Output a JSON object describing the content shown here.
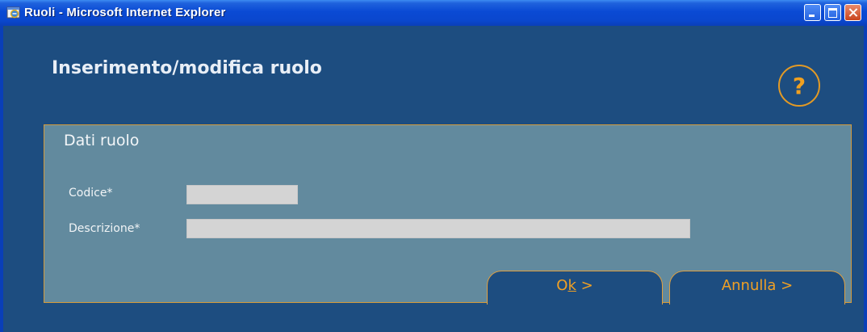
{
  "window": {
    "title": "Ruoli - Microsoft Internet Explorer"
  },
  "page": {
    "heading": "Inserimento/modifica ruolo",
    "help_symbol": "?"
  },
  "panel": {
    "title": "Dati ruolo",
    "fields": {
      "codice": {
        "label": "Codice*",
        "value": ""
      },
      "descrizione": {
        "label": "Descrizione*",
        "value": ""
      }
    }
  },
  "buttons": {
    "ok_prefix": "O",
    "ok_underline": "k",
    "ok_suffix": " >",
    "annulla": "Annulla >"
  },
  "colors": {
    "titlebar": "#0a4ad4",
    "background": "#1d4d80",
    "panel": "#628a9e",
    "accent": "#f0a020",
    "field": "#d4d4d4"
  }
}
